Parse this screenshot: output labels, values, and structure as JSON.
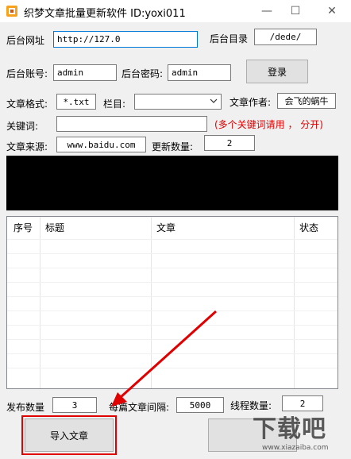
{
  "window": {
    "title": "织梦文章批量更新软件   ID:yoxi011",
    "minimize": "—",
    "maximize": "☐",
    "close": "✕"
  },
  "form": {
    "backend_url_label": "后台网址",
    "backend_url_value": "http://127.0",
    "backend_dir_label": "后台目录",
    "backend_dir_value": "/dede/",
    "account_label": "后台账号:",
    "account_value": "admin",
    "password_label": "后台密码:",
    "password_value": "admin",
    "login_label": "登录",
    "format_label": "文章格式:",
    "format_value": "*.txt",
    "column_label": "栏目:",
    "column_value": "",
    "author_label": "文章作者:",
    "author_value": "会飞的蜗牛",
    "keywords_label": "关键词:",
    "keywords_value": "",
    "keywords_hint": "(多个关键词请用 ， 分开)",
    "source_label": "文章来源:",
    "source_value": "www.baidu.com",
    "update_count_label": "更新数量:",
    "update_count_value": "2"
  },
  "table": {
    "columns": [
      "序号",
      "标题",
      "文章",
      "状态"
    ]
  },
  "bottom": {
    "publish_count_label": "发布数量",
    "publish_count_value": "3",
    "interval_label": "每篇文章间隔:",
    "interval_value": "5000",
    "threads_label": "线程数量:",
    "threads_value": "2",
    "import_label": "导入文章",
    "second_button_label": ""
  },
  "watermark": {
    "text": "下载吧",
    "url": "www.xiazaiba.com"
  },
  "colors": {
    "highlight": "#e00000",
    "arrow": "#e00000",
    "log_bg": "#000000"
  }
}
